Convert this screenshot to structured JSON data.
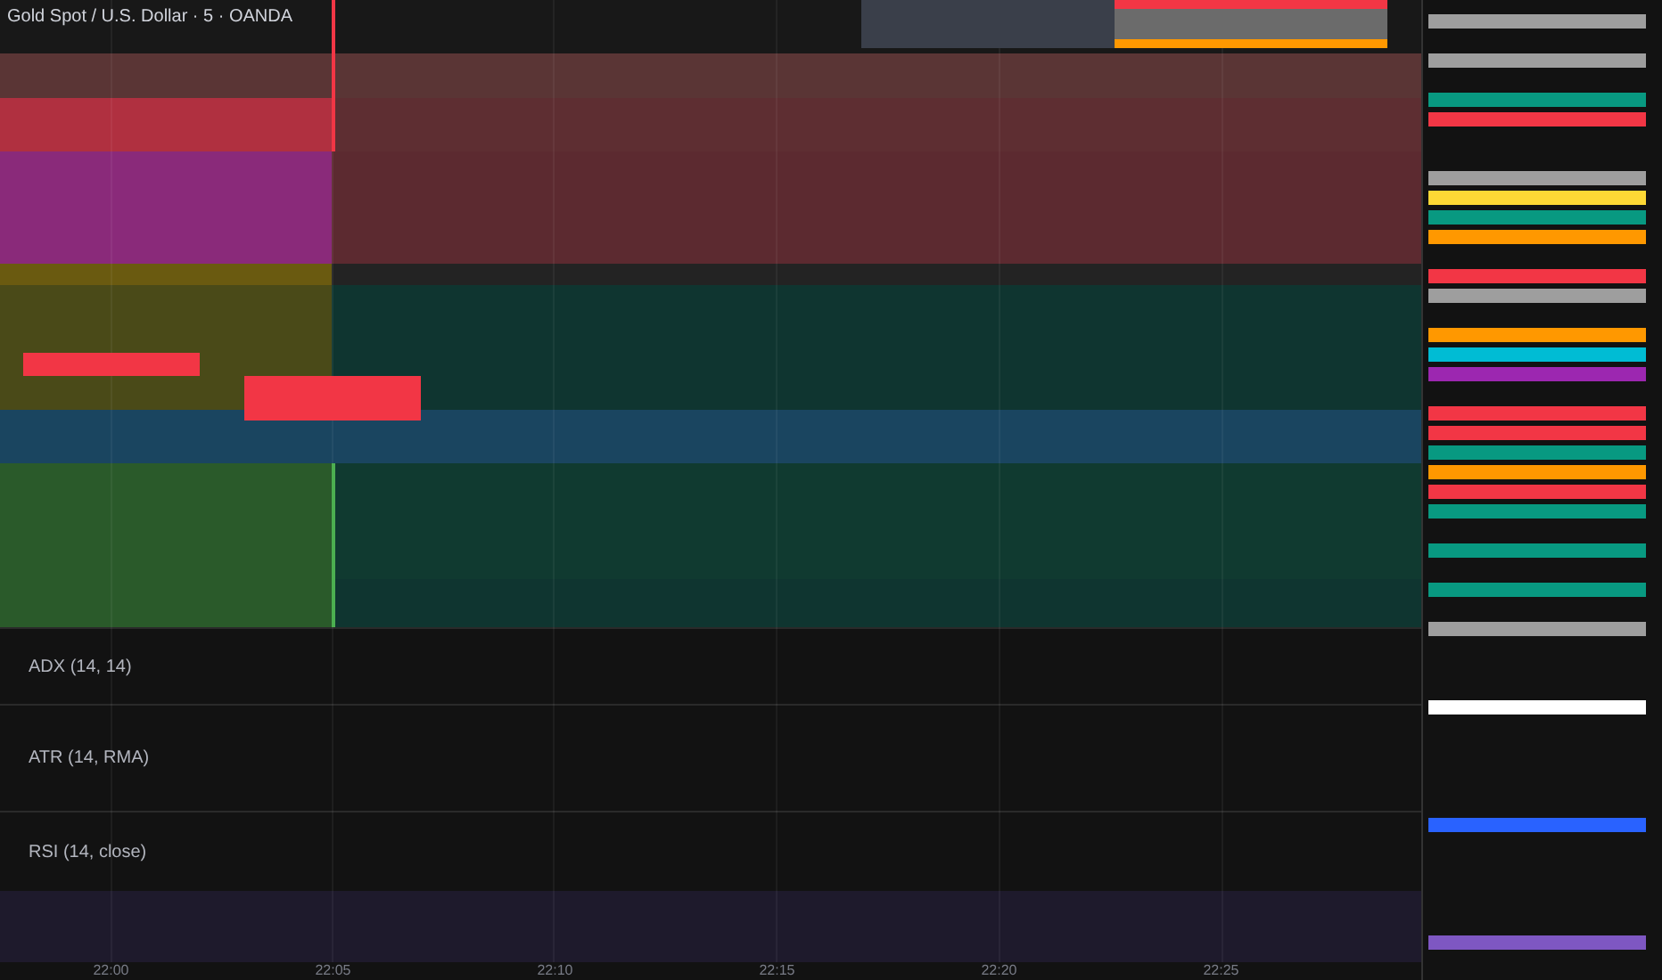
{
  "legend": {
    "title": "Gold Spot / U.S. Dollar · 5 · OANDA"
  },
  "indicators": [
    {
      "label": "ADX (14, 14)"
    },
    {
      "label": "ATR (14, RMA)"
    },
    {
      "label": "RSI (14, close)"
    }
  ],
  "time_axis": [
    "22:00",
    "22:05",
    "22:10",
    "22:15",
    "22:20",
    "22:25"
  ],
  "price_tags": [
    {
      "kind": "tag",
      "color": "#9e9e9e"
    },
    {
      "kind": "gap"
    },
    {
      "kind": "tag",
      "color": "#9e9e9e"
    },
    {
      "kind": "gap"
    },
    {
      "kind": "tag",
      "color": "#089981"
    },
    {
      "kind": "tag",
      "color": "#f23645"
    },
    {
      "kind": "gap"
    },
    {
      "kind": "gap"
    },
    {
      "kind": "tag",
      "color": "#9e9e9e"
    },
    {
      "kind": "tag",
      "color": "#fdd835"
    },
    {
      "kind": "tag",
      "color": "#089981"
    },
    {
      "kind": "tag",
      "color": "#ff9800"
    },
    {
      "kind": "gap"
    },
    {
      "kind": "tag",
      "color": "#f23645"
    },
    {
      "kind": "tag",
      "color": "#9e9e9e"
    },
    {
      "kind": "gap"
    },
    {
      "kind": "tag",
      "color": "#ff9800"
    },
    {
      "kind": "tag",
      "color": "#00bcd4"
    },
    {
      "kind": "tag",
      "color": "#9c27b0"
    },
    {
      "kind": "gap"
    },
    {
      "kind": "tag",
      "color": "#f23645"
    },
    {
      "kind": "tag",
      "color": "#f23645"
    },
    {
      "kind": "tag",
      "color": "#089981"
    },
    {
      "kind": "tag",
      "color": "#ff9800"
    },
    {
      "kind": "tag",
      "color": "#f23645"
    },
    {
      "kind": "tag",
      "color": "#089981"
    },
    {
      "kind": "gap"
    },
    {
      "kind": "tag",
      "color": "#089981"
    },
    {
      "kind": "gap"
    },
    {
      "kind": "tag",
      "color": "#089981"
    },
    {
      "kind": "gap"
    },
    {
      "kind": "tag",
      "color": "#9e9e9e"
    },
    {
      "kind": "gap"
    },
    {
      "kind": "gap"
    },
    {
      "kind": "gap"
    },
    {
      "kind": "tag",
      "color": "#ffffff"
    },
    {
      "kind": "gap"
    },
    {
      "kind": "gap"
    },
    {
      "kind": "gap"
    },
    {
      "kind": "gap"
    },
    {
      "kind": "gap"
    },
    {
      "kind": "tag",
      "color": "#2962ff"
    },
    {
      "kind": "gap"
    },
    {
      "kind": "gap"
    },
    {
      "kind": "gap"
    },
    {
      "kind": "gap"
    },
    {
      "kind": "gap"
    },
    {
      "kind": "tag",
      "color": "#7e57c2"
    }
  ]
}
